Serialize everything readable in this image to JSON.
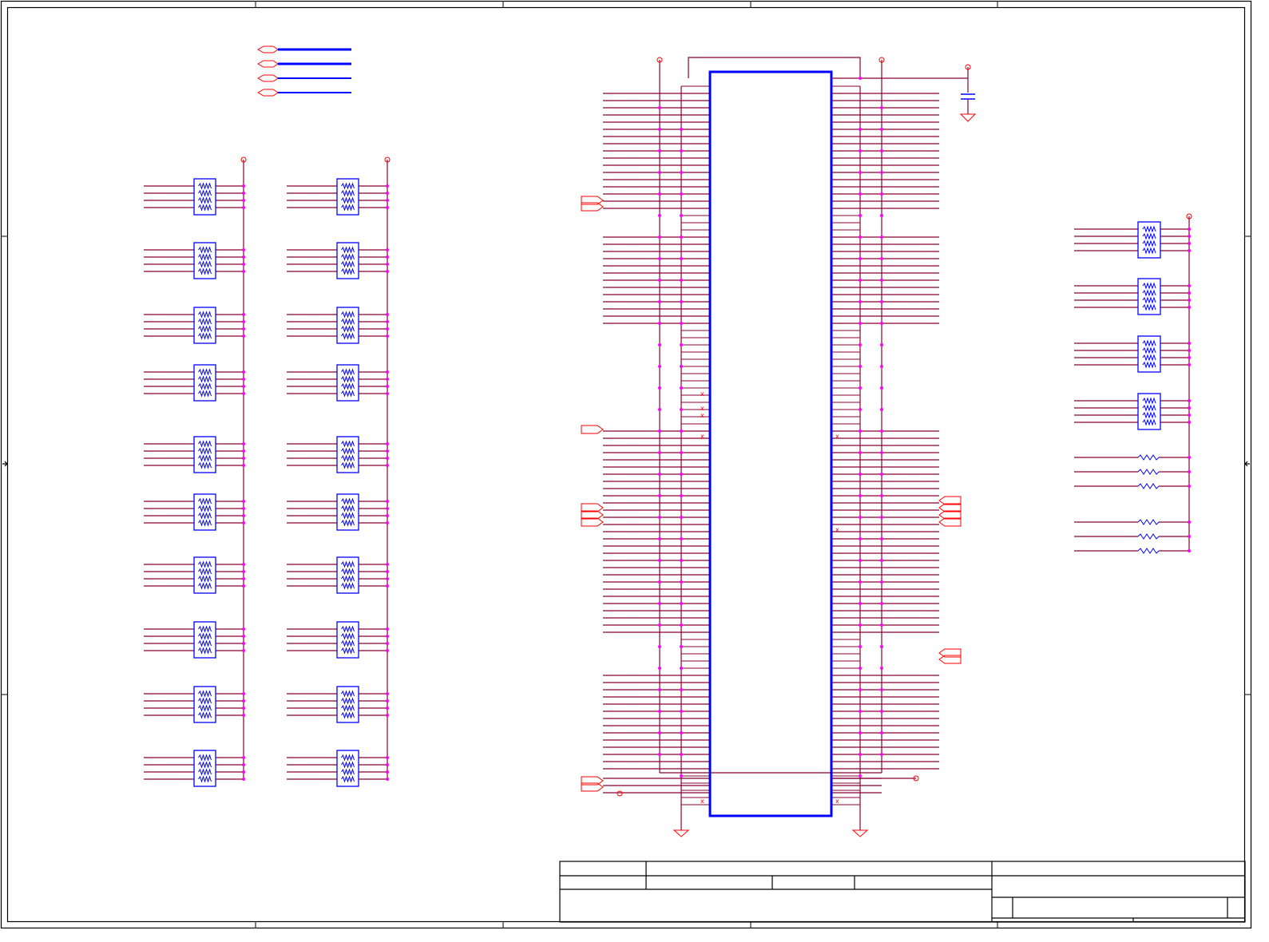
{
  "sheet": {
    "title": "",
    "background": "#ffffff",
    "colors": {
      "border": "#000000",
      "wire": "#8b0035",
      "junction": "#ff00ff",
      "component": "#0000ff",
      "power": "#ff0000"
    }
  },
  "title_block": {
    "cells": []
  },
  "components": {
    "main_ic": {
      "kind": "connector",
      "label": ""
    },
    "resistor_networks": {
      "left_column_count": 10,
      "middle_column_count": 10,
      "right_column_count": 4
    },
    "discrete_resistors": {
      "count": 6
    },
    "decoupling_capacitor": {
      "count": 1
    }
  },
  "icons": {
    "resistor_network": "resistor-network-icon",
    "resistor": "resistor-icon",
    "capacitor": "capacitor-icon",
    "ground": "ground-icon",
    "power_port": "power-port-icon",
    "off_page_connector": "off-page-connector-icon",
    "no_connect": "no-connect-icon"
  }
}
